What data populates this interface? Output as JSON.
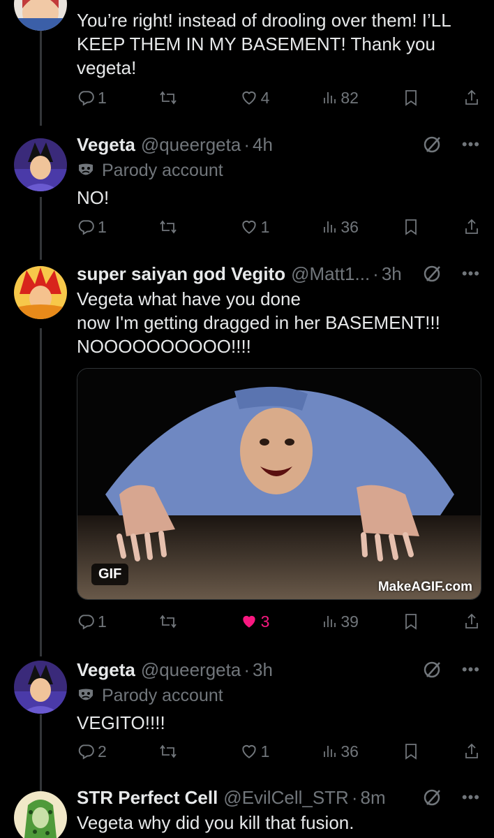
{
  "tweets": [
    {
      "body": "You’re right! instead of drooling over them! I’LL KEEP THEM IN MY BASEMENT! Thank you vegeta!",
      "replies": "1",
      "retweets": "",
      "likes": "4",
      "views": "82"
    },
    {
      "name": "Vegeta",
      "handle": "@queergeta",
      "time": "4h",
      "parody_label": "Parody account",
      "body": "NO!",
      "replies": "1",
      "retweets": "",
      "likes": "1",
      "views": "36"
    },
    {
      "name": "super saiyan god Vegito",
      "handle": "@Matt1...",
      "time": "3h",
      "body": "Vegeta what have you done\nnow I'm getting dragged in her BASEMENT!!!\nNOOOOOOOOOO!!!!",
      "media": {
        "badge": "GIF",
        "watermark": "MakeAGIF.com"
      },
      "replies": "1",
      "retweets": "",
      "likes": "3",
      "views": "39"
    },
    {
      "name": "Vegeta",
      "handle": "@queergeta",
      "time": "3h",
      "parody_label": "Parody account",
      "body": "VEGITO!!!!",
      "replies": "2",
      "retweets": "",
      "likes": "1",
      "views": "36"
    },
    {
      "name": "STR Perfect Cell",
      "handle": "@EvilCell_STR",
      "time": "8m",
      "body": "Vegeta why did you kill that fusion."
    }
  ],
  "separator": "·",
  "colors": {
    "like_active": "#f91880",
    "muted": "#71767b",
    "text": "#e7e9ea",
    "background": "#000000"
  }
}
